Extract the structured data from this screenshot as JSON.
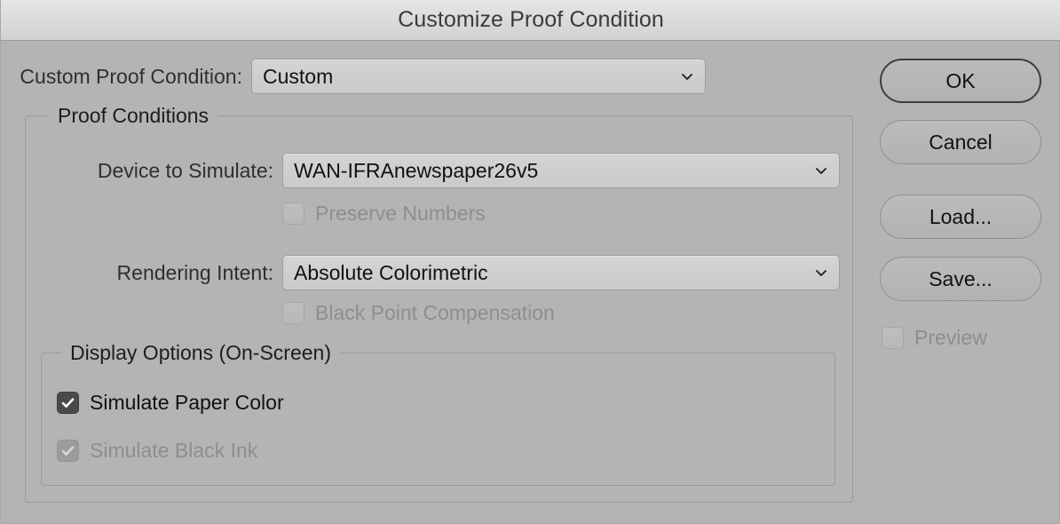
{
  "window": {
    "title": "Customize Proof Condition"
  },
  "top_row": {
    "label": "Custom Proof Condition:",
    "value": "Custom",
    "chevron_icon": "chevron-down-icon"
  },
  "proof_conditions": {
    "legend": "Proof Conditions",
    "device": {
      "label": "Device to Simulate:",
      "value": "WAN-IFRAnewspaper26v5",
      "chevron_icon": "chevron-down-icon"
    },
    "preserve_numbers": {
      "label": "Preserve Numbers",
      "checked": false,
      "enabled": false
    },
    "rendering_intent": {
      "label": "Rendering Intent:",
      "value": "Absolute Colorimetric",
      "chevron_icon": "chevron-down-icon"
    },
    "black_point_compensation": {
      "label": "Black Point Compensation",
      "checked": false,
      "enabled": false
    },
    "display_options": {
      "legend": "Display Options (On-Screen)",
      "simulate_paper_color": {
        "label": "Simulate Paper Color",
        "checked": true,
        "enabled": true
      },
      "simulate_black_ink": {
        "label": "Simulate Black Ink",
        "checked": true,
        "enabled": false
      }
    }
  },
  "buttons": {
    "ok": "OK",
    "cancel": "Cancel",
    "load": "Load...",
    "save": "Save..."
  },
  "preview": {
    "label": "Preview",
    "checked": false,
    "enabled": false
  },
  "colors": {
    "dialog_background": "#b4b4b4",
    "titlebar_top": "#e6e6e6",
    "titlebar_bottom": "#d2d2d2",
    "field_background": "#cdcdcd",
    "border": "#9a9a9a",
    "text": "#111111",
    "disabled_text": "#8e8e8e",
    "checkbox_checked": "#4a4a4a",
    "checkbox_checked_disabled": "#9c9c9c"
  }
}
